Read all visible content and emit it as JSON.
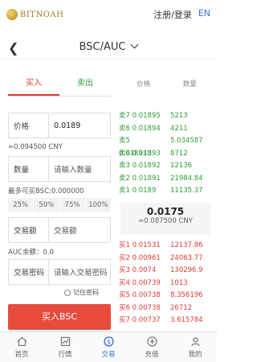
{
  "header": {
    "logo_text": "BITNOAH",
    "auth": "注册/登录",
    "lang": "EN"
  },
  "pair": {
    "title": "BSC/AUC"
  },
  "tabs": {
    "buy": "买入",
    "sell": "卖出"
  },
  "form": {
    "price_label": "价格",
    "price_value": "0.0189",
    "price_cny": "≈0.094500 CNY",
    "qty_label": "数量",
    "qty_placeholder": "请输入数量",
    "max_buy": "最多可买BSC:0.000000",
    "percents": [
      "25%",
      "50%",
      "75%",
      "100%"
    ],
    "amount_label": "交易额",
    "amount_placeholder": "交易额",
    "balance": "AUC余额：0.0",
    "pwd_label": "交易密码",
    "pwd_placeholder": "请输入交易密码",
    "remember": "记住密码",
    "buy_button": "买入BSC"
  },
  "orderbook": {
    "col_price": "价格",
    "col_qty": "数量",
    "sells": [
      {
        "label": "卖7",
        "price": "0.01895",
        "qty": "5213"
      },
      {
        "label": "卖6",
        "price": "0.01894",
        "qty": "4211"
      },
      {
        "label": "卖5",
        "price": "0.018933",
        "qty": "5.034587"
      },
      {
        "label": "卖4",
        "price": "0.01893",
        "qty": "8712"
      },
      {
        "label": "卖3",
        "price": "0.01892",
        "qty": "12136"
      },
      {
        "label": "卖2",
        "price": "0.01891",
        "qty": "21984.84"
      },
      {
        "label": "卖1",
        "price": "0.0189",
        "qty": "11135.37"
      }
    ],
    "last_price": "0.0175",
    "last_cny": "≈0.087500 CNY",
    "buys": [
      {
        "label": "买1",
        "price": "0.01531",
        "qty": "12137.86"
      },
      {
        "label": "买2",
        "price": "0.00961",
        "qty": "24063.77"
      },
      {
        "label": "买3",
        "price": "0.0074",
        "qty": "130296.9"
      },
      {
        "label": "买4",
        "price": "0.00739",
        "qty": "1013"
      },
      {
        "label": "买5",
        "price": "0.00738",
        "qty": "8.356196"
      },
      {
        "label": "买6",
        "price": "0.00738",
        "qty": "26712"
      },
      {
        "label": "买7",
        "price": "0.00737",
        "qty": "3.615784"
      }
    ]
  },
  "nav": {
    "items": [
      {
        "label": "首页",
        "icon": "home-icon"
      },
      {
        "label": "行情",
        "icon": "chart-icon"
      },
      {
        "label": "交易",
        "icon": "trade-icon"
      },
      {
        "label": "充值",
        "icon": "recharge-icon"
      },
      {
        "label": "我的",
        "icon": "profile-icon"
      }
    ]
  },
  "colors": {
    "buy": "#e53935",
    "sell": "#2e9c3b",
    "accent": "#3b6fd8"
  }
}
